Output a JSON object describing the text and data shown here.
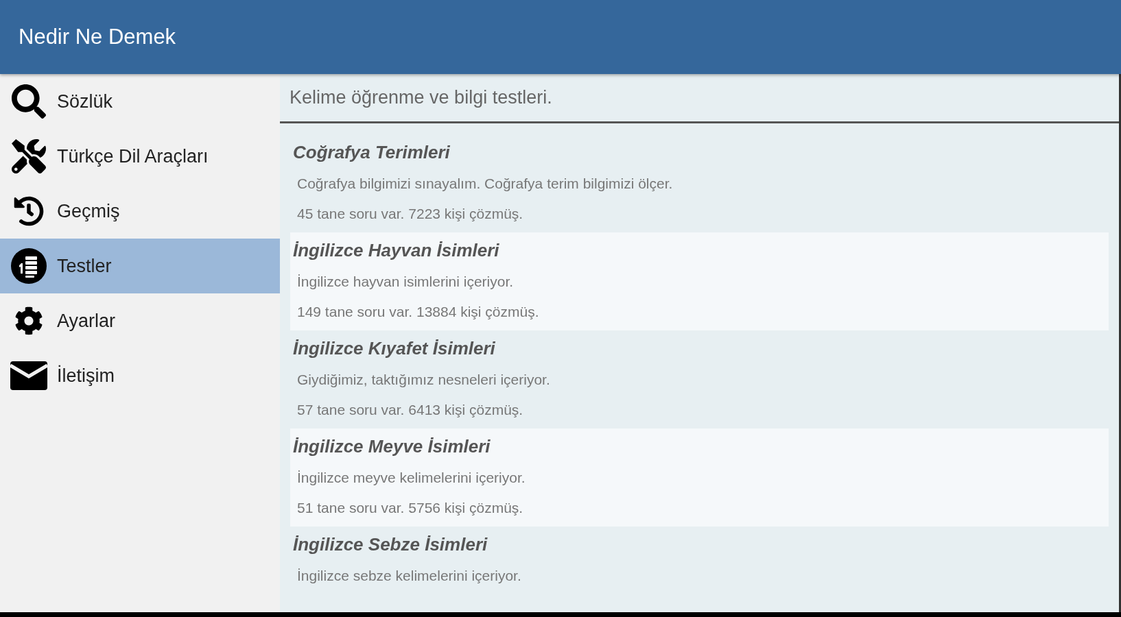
{
  "app_bar": {
    "title": "Nedir Ne Demek"
  },
  "sidebar": {
    "items": [
      {
        "label": "Sözlük",
        "selected": false
      },
      {
        "label": "Türkçe Dil Araçları",
        "selected": false
      },
      {
        "label": "Geçmiş",
        "selected": false
      },
      {
        "label": "Testler",
        "selected": true
      },
      {
        "label": "Ayarlar",
        "selected": false
      },
      {
        "label": "İletişim",
        "selected": false
      }
    ]
  },
  "content": {
    "description": "Kelime öğrenme ve bilgi testleri.",
    "tests": [
      {
        "title": "Coğrafya Terimleri",
        "description": "Coğrafya bilgimizi sınayalım. Coğrafya terim bilgimizi ölçer.",
        "stats": "45 tane soru var. 7223 kişi çözmüş."
      },
      {
        "title": "İngilizce Hayvan İsimleri",
        "description": "İngilizce hayvan isimlerini içeriyor.",
        "stats": "149 tane soru var. 13884 kişi çözmüş."
      },
      {
        "title": "İngilizce Kıyafet İsimleri",
        "description": "Giydiğimiz, taktığımız nesneleri içeriyor.",
        "stats": "57 tane soru var. 6413 kişi çözmüş."
      },
      {
        "title": "İngilizce Meyve İsimleri",
        "description": "İngilizce meyve kelimelerini içeriyor.",
        "stats": "51 tane soru var. 5756 kişi çözmüş."
      },
      {
        "title": "İngilizce Sebze İsimleri",
        "description": "İngilizce sebze kelimelerini içeriyor."
      }
    ]
  }
}
